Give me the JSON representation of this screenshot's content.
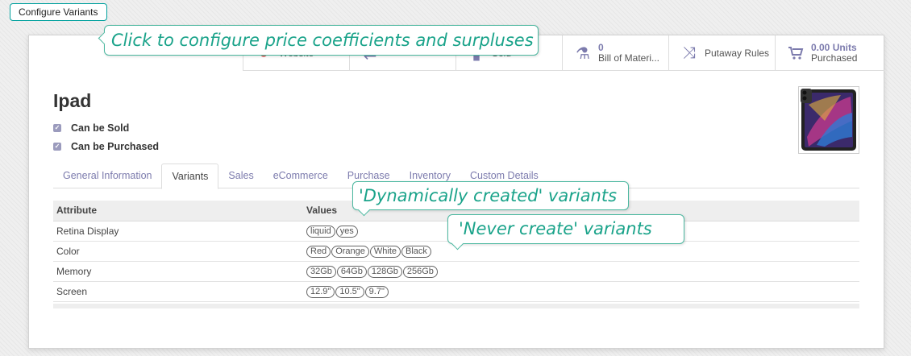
{
  "topbar": {
    "configure_variants": "Configure Variants"
  },
  "smart_buttons": [
    {
      "icon": "globe-icon",
      "line1": "",
      "line2": "Website"
    },
    {
      "icon": "exchange-icon",
      "line1": "",
      "line2": ""
    },
    {
      "icon": "bar-chart-icon",
      "line1": "",
      "line2": "Sold"
    },
    {
      "icon": "flask-icon",
      "line1": "0",
      "line2": "Bill of Materi..."
    },
    {
      "icon": "random-icon",
      "line1": "",
      "line2": "Putaway Rules"
    },
    {
      "icon": "cart-icon",
      "line1": "0.00 Units",
      "line2": "Purchased"
    }
  ],
  "product": {
    "name": "Ipad",
    "can_be_sold": "Can be Sold",
    "can_be_purchased": "Can be Purchased"
  },
  "tabs": [
    "General Information",
    "Variants",
    "Sales",
    "eCommerce",
    "Purchase",
    "Inventory",
    "Custom Details"
  ],
  "active_tab": "Variants",
  "variants_table": {
    "headers": [
      "Attribute",
      "Values"
    ],
    "rows": [
      {
        "attribute": "Retina Display",
        "values": [
          "liquid",
          "yes"
        ]
      },
      {
        "attribute": "Color",
        "values": [
          "Red",
          "Orange",
          "White",
          "Black"
        ]
      },
      {
        "attribute": "Memory",
        "values": [
          "32Gb",
          "64Gb",
          "128Gb",
          "256Gb"
        ]
      },
      {
        "attribute": "Screen",
        "values": [
          "12.9\"",
          "10.5\"",
          "9.7\""
        ]
      }
    ]
  },
  "callouts": {
    "configure": "Click to configure price coefficients and surpluses",
    "dynamic": "'Dynamically created' variants",
    "never": "'Never create' variants"
  },
  "colors": {
    "accent": "#7c7bad",
    "callout": "#1aa38a"
  }
}
